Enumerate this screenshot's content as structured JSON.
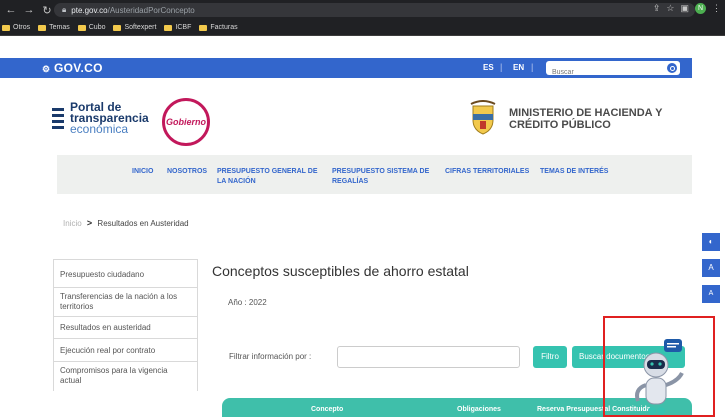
{
  "browser": {
    "url_domain": "pte.gov.co",
    "url_path": "/AusteridadPorConcepto",
    "profile_initial": "N",
    "bookmarks": [
      "Otros",
      "Temas",
      "Cubo",
      "Softexpert",
      "ICBF",
      "Facturas"
    ]
  },
  "govbar": {
    "logo": "GOV.CO",
    "lang_es": "ES",
    "lang_sep": "|",
    "lang_en": "EN",
    "search_placeholder": "Buscar",
    "color": "#3366cc"
  },
  "header": {
    "portal_line1": "Portal de",
    "portal_line2": "transparencia",
    "portal_line3": "económica",
    "gob_logo_text": "Gobierno",
    "ministry_line1": "MINISTERIO DE HACIENDA Y",
    "ministry_line2": "CRÉDITO PÚBLICO"
  },
  "nav": {
    "items": [
      {
        "l1": "INICIO",
        "l2": ""
      },
      {
        "l1": "NOSOTROS",
        "l2": ""
      },
      {
        "l1": "PRESUPUESTO GENERAL DE",
        "l2": "LA NACIÓN"
      },
      {
        "l1": "PRESUPUESTO SISTEMA DE",
        "l2": "REGALÍAS"
      },
      {
        "l1": "CIFRAS TERRITORIALES",
        "l2": ""
      },
      {
        "l1": "TEMAS DE INTERÉS",
        "l2": ""
      }
    ]
  },
  "breadcrumb": {
    "home": "Inicio",
    "sep": ">",
    "current": "Resultados en Austeridad"
  },
  "sidebar": {
    "items": [
      "Presupuesto ciudadano",
      "Transferencias de la nación a los territorios",
      "Resultados en austeridad",
      "Ejecución real por contrato",
      "Compromisos para la vigencia actual"
    ]
  },
  "main": {
    "title": "Conceptos susceptibles de ahorro estatal",
    "year": "Año : 2022",
    "filter_label": "Filtrar información por :",
    "filter_button": "Filtro",
    "search_button": "Buscar documentos"
  },
  "table": {
    "headers": [
      "Concepto",
      "Obligaciones",
      "Reserva Presupuestal Constituida"
    ]
  },
  "accessibility": {
    "contrast": "◐",
    "increase": "A",
    "decrease": "A"
  },
  "colors": {
    "accent": "#35c3b0",
    "highlight": "#e02020"
  }
}
